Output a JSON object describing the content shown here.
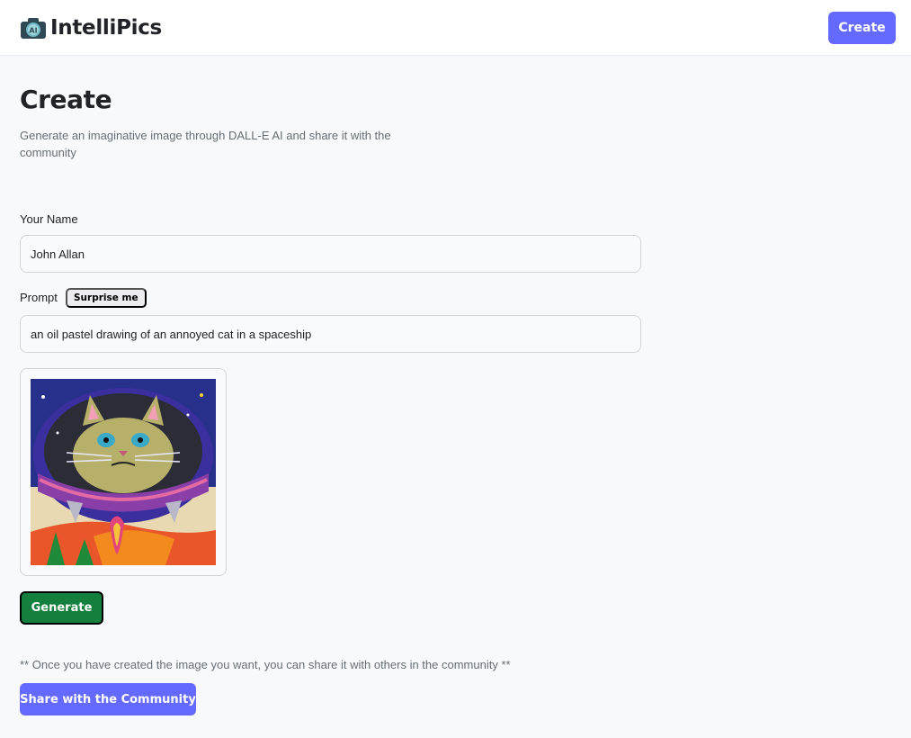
{
  "header": {
    "logo_text": "IntelliPics",
    "create_label": "Create"
  },
  "page": {
    "title": "Create",
    "subtitle": "Generate an imaginative image through DALL-E AI and share it with the community"
  },
  "form": {
    "name_label": "Your Name",
    "name_value": "John Allan",
    "prompt_label": "Prompt",
    "surprise_label": "Surprise me",
    "prompt_value": "an oil pastel drawing of an annoyed cat in a spaceship",
    "generate_label": "Generate"
  },
  "share": {
    "note": "** Once you have created the image you want, you can share it with others in the community **",
    "button_label": "Share with the Community"
  },
  "colors": {
    "primary": "#6469ff",
    "generate": "#15803d",
    "text": "#222328",
    "muted": "#666e75"
  }
}
